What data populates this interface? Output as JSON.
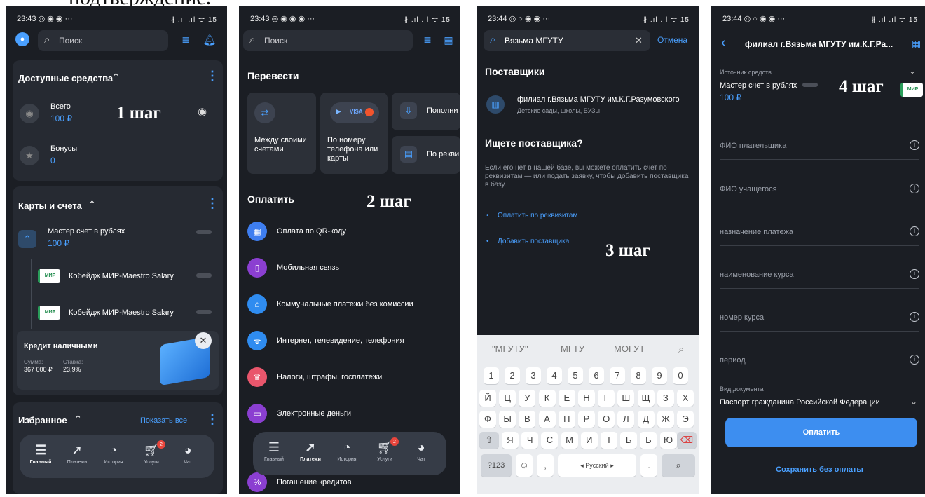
{
  "page": {
    "clipped_caption": "подтверждение."
  },
  "steps": {
    "s1": "1 шаг",
    "s2": "2 шаг",
    "s3": "3 шаг",
    "s4": "4 шаг"
  },
  "screen1": {
    "time": "23:43 ◎ ◉ ◉ ···",
    "status_right": "∦ .ıl .ıl ᯤ 15",
    "search_placeholder": "Поиск",
    "available": {
      "title": "Доступные средства",
      "total_label": "Всего",
      "total_value": "100 ₽",
      "bonus_label": "Бонусы",
      "bonus_value": "0"
    },
    "cards": {
      "title": "Карты и счета",
      "account": "Мастер счет в рублях",
      "account_value": "100 ₽",
      "card1": "Кобейдж МИР-Maestro Salary",
      "card2": "Кобейдж МИР-Maestro Salary",
      "card_badge": "МИР"
    },
    "credit": {
      "title": "Кредит наличными",
      "sum_label": "Сумма:",
      "sum_value": "367 000 ₽",
      "rate_label": "Ставка:",
      "rate_value": "23,9%"
    },
    "favorites": {
      "title": "Избранное",
      "show_all": "Показать все"
    },
    "nav": [
      "Главный",
      "Платежи",
      "История",
      "Услуги",
      "Чат"
    ],
    "nav_badge": "2"
  },
  "screen2": {
    "time": "23:43 ◎ ◉ ◉ ◉ ···",
    "status_right": "∦ .ıl .ıl ᯤ 15",
    "search_placeholder": "Поиск",
    "transfer_title": "Перевести",
    "tile_between": "Между своими счетами",
    "tile_phone": "По номеру телефона или карты",
    "tile_visa": "VISA",
    "tile_topup": "Пополни",
    "tile_req": "По рекви",
    "pay_title": "Оплатить",
    "items": [
      "Оплата по QR-коду",
      "Мобильная связь",
      "Коммунальные платежи без комиссии",
      "Интернет, телевидение, телефония",
      "Налоги, штрафы, госплатежи",
      "Электронные деньги",
      "Погашение кредитов"
    ],
    "nav": [
      "Главный",
      "Платежи",
      "История",
      "Услуги",
      "Чат"
    ],
    "nav_badge": "2"
  },
  "screen3": {
    "time": "23:44 ◎ ○ ◉ ◉ ···",
    "status_right": "∦ .ıl .ıl ᯤ 15",
    "search_value": "Вязьма МГУТУ",
    "cancel": "Отмена",
    "suppliers_title": "Поставщики",
    "supplier_name": "филиал г.Вязьма МГУТУ им.К.Г.Разумовского",
    "supplier_sub": "Детские сады, школы, ВУЗы",
    "looking_title": "Ищете поставщика?",
    "looking_text": "Если его нет в нашей базе, вы можете оплатить счет по реквизитам — или подать заявку, чтобы добавить поставщика в базу.",
    "link1": "Оплатить по реквизитам",
    "link2": "Добавить поставщика",
    "suggestions": [
      "\"МГУТУ\"",
      "МГТУ",
      "МОГУТ"
    ],
    "digits": [
      "1",
      "2",
      "3",
      "4",
      "5",
      "6",
      "7",
      "8",
      "9",
      "0"
    ],
    "row1": [
      "Й",
      "Ц",
      "У",
      "К",
      "Е",
      "Н",
      "Г",
      "Ш",
      "Щ",
      "З",
      "Х"
    ],
    "row2": [
      "Ф",
      "Ы",
      "В",
      "А",
      "П",
      "Р",
      "О",
      "Л",
      "Д",
      "Ж",
      "Э"
    ],
    "row3": [
      "Я",
      "Ч",
      "С",
      "М",
      "И",
      "Т",
      "Ь",
      "Б",
      "Ю"
    ],
    "sym": "?123",
    "space": "◂ Русский ▸",
    "punct": ".",
    "comma": ","
  },
  "screen4": {
    "time": "23:44 ◎ ○ ◉ ◉ ···",
    "status_right": "∦ .ıl .ıl ᯤ 15",
    "header": "филиал г.Вязьма МГУТУ им.К.Г.Ра...",
    "source_label": "Источник средств",
    "source_account": "Мастер счет в рублях",
    "source_value": "100 ₽",
    "fields": [
      "ФИО плательщика",
      "ФИО учащегося",
      "назначение платежа",
      "наименование курса",
      "номер курса",
      "период"
    ],
    "doc_label": "Вид документа",
    "doc_value": "Паспорт гражданина Российской Федерации",
    "pay_button": "Оплатить",
    "save_link": "Сохранить без оплаты",
    "card_badge": "МИР"
  }
}
